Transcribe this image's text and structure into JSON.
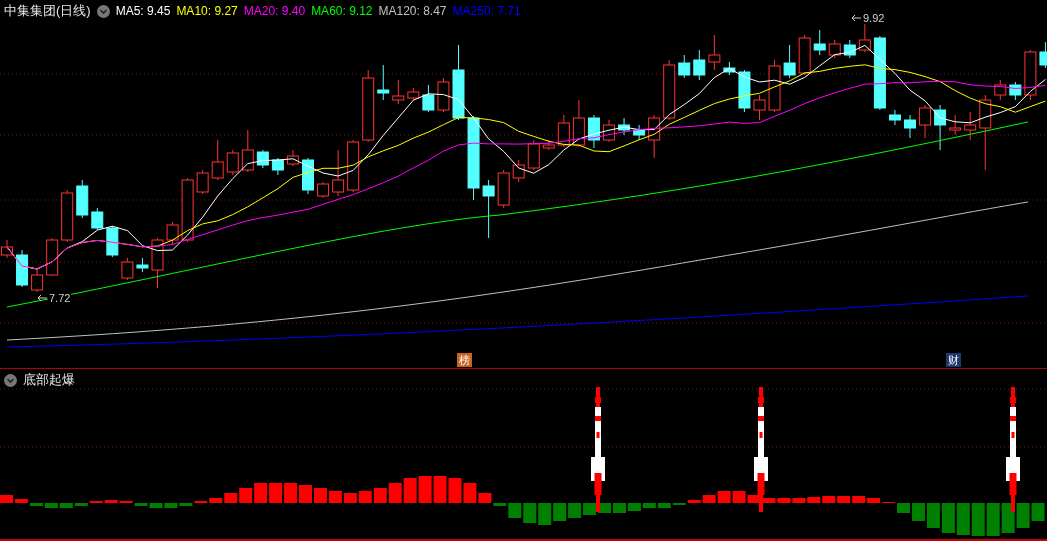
{
  "header": {
    "title": "中集集团(日线)",
    "indicators": [
      {
        "label": "MA5: 9.45",
        "color": "#ffffff"
      },
      {
        "label": "MA10: 9.27",
        "color": "#ffff00"
      },
      {
        "label": "MA20: 9.40",
        "color": "#ff00ff"
      },
      {
        "label": "MA60: 9.12",
        "color": "#00ff00"
      },
      {
        "label": "MA120: 8.47",
        "color": "#c0c0c0"
      },
      {
        "label": "MA250: 7.71",
        "color": "#0000ff"
      }
    ]
  },
  "price_labels": [
    {
      "text": "9.92"
    },
    {
      "text": "7.72"
    }
  ],
  "badges": [
    {
      "text": "榜",
      "color": "#c8641e"
    },
    {
      "text": "财",
      "color": "#1e3a6e"
    }
  ],
  "indicator_panel": {
    "title": "底部起爆"
  }
}
